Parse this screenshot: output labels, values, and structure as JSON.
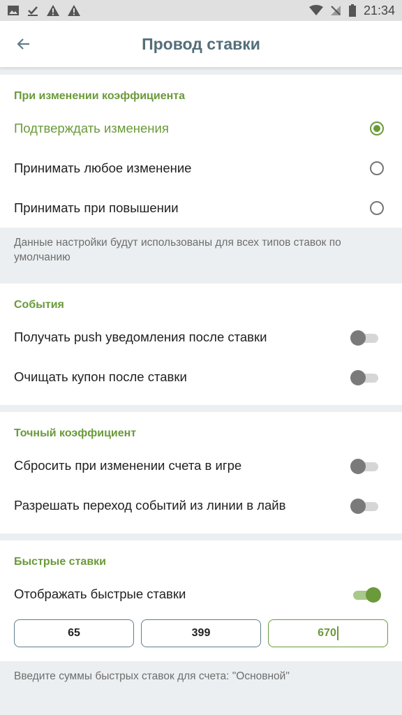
{
  "status_bar": {
    "time": "21:34"
  },
  "appbar": {
    "title": "Провод ставки"
  },
  "odds_section": {
    "header": "При изменении коэффициента",
    "options": [
      {
        "label": "Подтверждать изменения",
        "selected": true
      },
      {
        "label": "Принимать любое изменение",
        "selected": false
      },
      {
        "label": "Принимать при повышении",
        "selected": false
      }
    ],
    "note": "Данные настройки будут использованы для всех типов ставок по умолчанию"
  },
  "events_section": {
    "header": "События",
    "toggles": [
      {
        "label": "Получать push уведомления после ставки",
        "on": false
      },
      {
        "label": "Очищать купон после ставки",
        "on": false
      }
    ]
  },
  "exact_odds_section": {
    "header": "Точный коэффициент",
    "toggles": [
      {
        "label": "Сбросить при изменении счета в игре",
        "on": false
      },
      {
        "label": "Разрешать переход событий из линии в лайв",
        "on": false
      }
    ]
  },
  "quick_bets_section": {
    "header": "Быстрые ставки",
    "toggle": {
      "label": "Отображать быстрые ставки",
      "on": true
    },
    "amounts": [
      "65",
      "399",
      "670"
    ],
    "note": "Введите суммы быстрых ставок для счета: \"Основной\""
  },
  "colors": {
    "accent": "#6a9a3a",
    "title": "#546e7a",
    "background": "#eceff1"
  }
}
